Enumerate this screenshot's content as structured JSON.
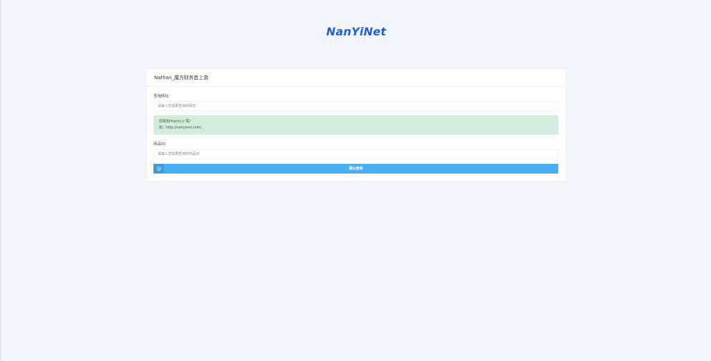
{
  "header": {
    "logo_text": "NanYiNet"
  },
  "card": {
    "title": "Nathan_魔方财务首上游"
  },
  "form": {
    "url_label": "查询网址:",
    "url_placeholder": "请输入您需要查询的网址",
    "hint_line1": "前需包http(s):// 尾/",
    "hint_line2": "如：http://nanyinet.com/",
    "product_label": "商品ID:",
    "product_placeholder": "请输入您需要查询的商品ID",
    "submit_label": "确认查询",
    "submit_icon": "check-circle-icon"
  },
  "colors": {
    "brand": "#1f5fd8",
    "accent": "#4aaef5",
    "alert_bg": "#d4ecdb"
  }
}
